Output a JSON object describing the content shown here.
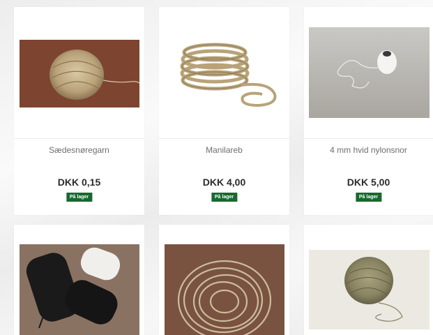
{
  "products": [
    {
      "name": "Sædesnøregarn",
      "price": "DKK 0,15",
      "stock_label": "På lager",
      "image_icon": "twine-ball-photo"
    },
    {
      "name": "Manilareb",
      "price": "DKK 4,00",
      "stock_label": "På lager",
      "image_icon": "manila-rope-coil-photo"
    },
    {
      "name": "4 mm hvid nylonsnor",
      "price": "DKK 5,00",
      "stock_label": "På lager",
      "image_icon": "white-nylon-spool-photo"
    },
    {
      "image_icon": "black-white-rope-rolls-photo"
    },
    {
      "image_icon": "rope-coil-photo"
    },
    {
      "image_icon": "twine-ball-photo"
    }
  ],
  "colors": {
    "stock_badge": "#17692f",
    "price_text": "#2b2b2b",
    "name_text": "#6e6e6e"
  }
}
